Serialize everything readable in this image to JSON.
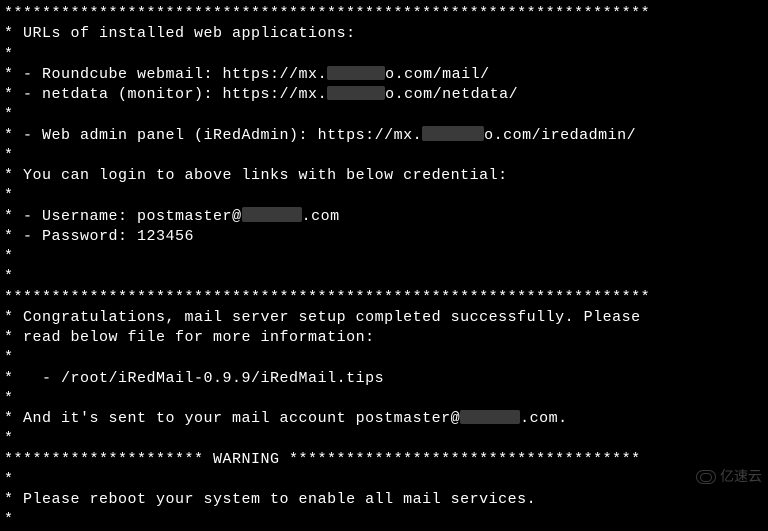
{
  "sep_full": "********************************************************************",
  "star": "*",
  "header": " URLs of installed web applications:",
  "roundcube_pre": " - Roundcube webmail: https://mx.",
  "roundcube_post": "o.com/mail/",
  "netdata_pre": " - netdata (monitor): https://mx.",
  "netdata_post": "o.com/netdata/",
  "admin_pre": " - Web admin panel (iRedAdmin): https://mx.",
  "admin_post": "o.com/iredadmin/",
  "login_intro": " You can login to above links with below credential:",
  "user_pre": " - Username: postmaster@",
  "user_post": ".com",
  "password": " - Password: 123456",
  "congrats_l1": " Congratulations, mail server setup completed successfully. Please",
  "congrats_l2": " read below file for more information:",
  "tips_path": "   - /root/iRedMail-0.9.9/iRedMail.tips",
  "sent_pre": " And it's sent to your mail account postmaster@",
  "sent_post": ".com.",
  "warn_pre": "*********************",
  "warn_word": " WARNING ",
  "warn_post": "*************************************",
  "reboot": " Please reboot your system to enable all mail services.",
  "watermark": "亿速云"
}
